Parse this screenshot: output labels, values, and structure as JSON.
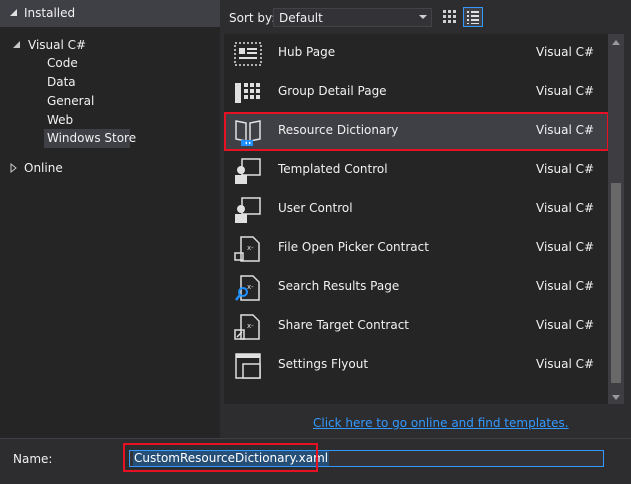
{
  "tree": {
    "installed": "Installed",
    "visual_csharp": "Visual C#",
    "children": [
      "Code",
      "Data",
      "General",
      "Web",
      "Windows Store"
    ],
    "selected": "Windows Store",
    "online": "Online"
  },
  "sort": {
    "label": "Sort by:",
    "value": "Default"
  },
  "templates": [
    {
      "name": "Hub Page",
      "lang": "Visual C#",
      "icon": "hub-page-icon"
    },
    {
      "name": "Group Detail Page",
      "lang": "Visual C#",
      "icon": "group-detail-page-icon"
    },
    {
      "name": "Resource Dictionary",
      "lang": "Visual C#",
      "icon": "resource-dictionary-icon",
      "selected": true
    },
    {
      "name": "Templated Control",
      "lang": "Visual C#",
      "icon": "templated-control-icon"
    },
    {
      "name": "User Control",
      "lang": "Visual C#",
      "icon": "user-control-icon"
    },
    {
      "name": "File Open Picker Contract",
      "lang": "Visual C#",
      "icon": "file-open-picker-icon"
    },
    {
      "name": "Search Results Page",
      "lang": "Visual C#",
      "icon": "search-results-icon"
    },
    {
      "name": "Share Target Contract",
      "lang": "Visual C#",
      "icon": "share-target-icon"
    },
    {
      "name": "Settings Flyout",
      "lang": "Visual C#",
      "icon": "settings-flyout-icon"
    }
  ],
  "online_link": "Click here to go online and find templates.",
  "name_field": {
    "label": "Name:",
    "value": "CustomResourceDictionary.xaml"
  },
  "colors": {
    "accent": "#3399ff",
    "highlight_border": "#e81123",
    "selection": "#3f3f46"
  }
}
